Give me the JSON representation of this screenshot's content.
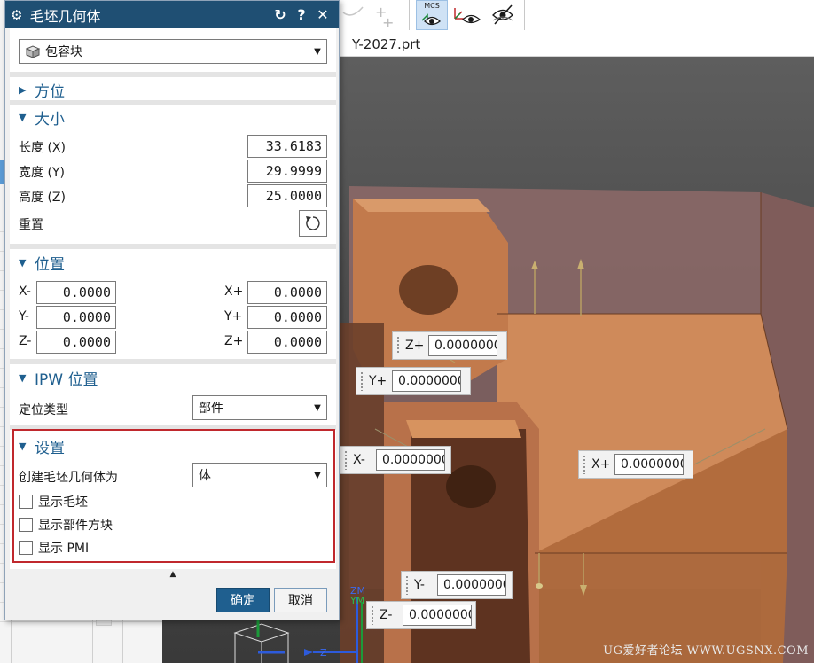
{
  "background": {
    "file_tab": "Y-2027.prt",
    "toolbar": {
      "mcs_label": "MCS"
    },
    "handles": [
      {
        "label": "Z+",
        "value": "0.0000000"
      },
      {
        "label": "Y+",
        "value": "0.0000000"
      },
      {
        "label": "X-",
        "value": "0.0000000"
      },
      {
        "label": "X+",
        "value": "0.0000000"
      },
      {
        "label": "Y-",
        "value": "0.0000000"
      },
      {
        "label": "Z-",
        "value": "0.0000000"
      }
    ],
    "triad": {
      "zm": "ZM",
      "ym": "YM",
      "z": "Z"
    },
    "watermark": "UG爱好者论坛 WWW.UGSNX.COM"
  },
  "dialog": {
    "title": "毛坯几何体",
    "type_select": "包容块",
    "orientation": {
      "title": "方位"
    },
    "size": {
      "title": "大小",
      "length_label": "长度 (X)",
      "length_value": "33.6183",
      "width_label": "宽度 (Y)",
      "width_value": "29.9999",
      "height_label": "高度 (Z)",
      "height_value": "25.0000",
      "reset_label": "重置"
    },
    "position": {
      "title": "位置",
      "xminus_label": "X-",
      "xminus_value": "0.0000",
      "yminus_label": "Y-",
      "yminus_value": "0.0000",
      "zminus_label": "Z-",
      "zminus_value": "0.0000",
      "xplus_label": "X+",
      "xplus_value": "0.0000",
      "yplus_label": "Y+",
      "yplus_value": "0.0000",
      "zplus_label": "Z+",
      "zplus_value": "0.0000"
    },
    "ipw": {
      "title": "IPW 位置",
      "locate_type_label": "定位类型",
      "locate_type_value": "部件"
    },
    "settings": {
      "title": "设置",
      "create_as_label": "创建毛坯几何体为",
      "create_as_value": "体",
      "show_blank": "显示毛坯",
      "show_block": "显示部件方块",
      "show_pmi": "显示 PMI"
    },
    "ok": "确定",
    "cancel": "取消"
  }
}
